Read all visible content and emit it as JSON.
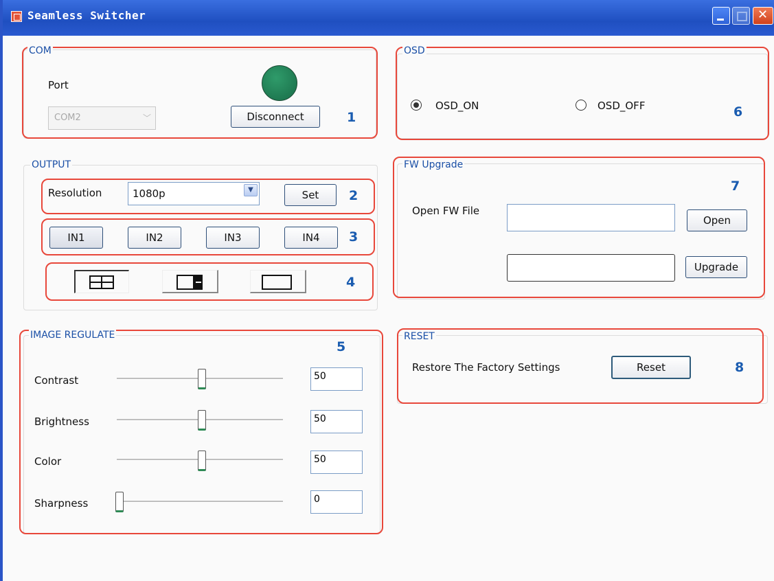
{
  "window": {
    "title": "Seamless Switcher"
  },
  "com": {
    "legend": "COM",
    "port_label": "Port",
    "port_value": "COM2",
    "disconnect_label": "Disconnect",
    "status_color": "#1f7a52",
    "number": "1"
  },
  "output": {
    "legend": "OUTPUT",
    "resolution_label": "Resolution",
    "resolution_value": "1080p",
    "set_label": "Set",
    "num_resolution": "2",
    "inputs": [
      "IN1",
      "IN2",
      "IN3",
      "IN4"
    ],
    "num_inputs": "3",
    "layouts": [
      "quad-layout-icon",
      "pip-layout-icon",
      "single-layout-icon"
    ],
    "num_layouts": "4"
  },
  "image": {
    "legend": "IMAGE REGULATE",
    "number": "5",
    "sliders": [
      {
        "label": "Contrast",
        "value": "50",
        "level": 0.5
      },
      {
        "label": "Brightness",
        "value": "50",
        "level": 0.5
      },
      {
        "label": "Color",
        "value": "50",
        "level": 0.5
      },
      {
        "label": "Sharpness",
        "value": "0",
        "level": 0
      }
    ]
  },
  "osd": {
    "legend": "OSD",
    "on_label": "OSD_ON",
    "off_label": "OSD_OFF",
    "selected": "OSD_ON",
    "number": "6"
  },
  "fw": {
    "legend": "FW Upgrade",
    "open_file_label": "Open FW File",
    "open_label": "Open",
    "upgrade_label": "Upgrade",
    "file_value": "",
    "progress_value": "",
    "number": "7"
  },
  "reset": {
    "legend": "RESET",
    "restore_label": "Restore The Factory Settings",
    "reset_label": "Reset",
    "number": "8"
  },
  "colors": {
    "titlebar": "#2a5ad0",
    "annotation_box": "#e8473a",
    "annotation_number": "#1a5cb0"
  }
}
